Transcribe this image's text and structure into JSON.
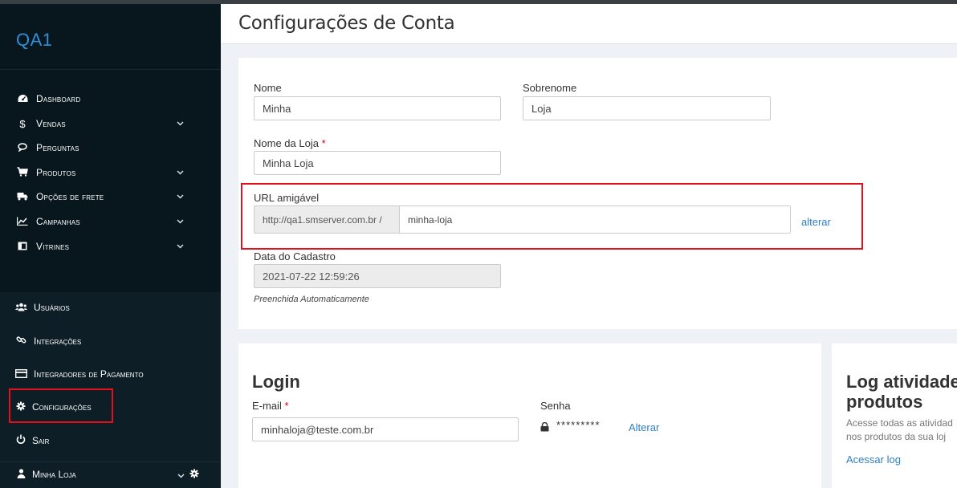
{
  "sidebar": {
    "brand": "QA1",
    "nav": [
      {
        "label": "Dashboard",
        "icon": "dashboard-icon",
        "chevron": false
      },
      {
        "label": "Vendas",
        "icon": "dollar-icon",
        "chevron": true
      },
      {
        "label": "Perguntas",
        "icon": "comments-icon",
        "chevron": false
      },
      {
        "label": "Produtos",
        "icon": "cart-icon",
        "chevron": true
      },
      {
        "label": "Opções de frete",
        "icon": "truck-icon",
        "chevron": true
      },
      {
        "label": "Campanhas",
        "icon": "chart-icon",
        "chevron": true
      },
      {
        "label": "Vitrines",
        "icon": "window-icon",
        "chevron": true
      }
    ],
    "lower": [
      {
        "label": "Usuários",
        "icon": "users-icon"
      },
      {
        "label": "Integrações",
        "icon": "link-icon"
      },
      {
        "label": "Integradores de Pagamento",
        "icon": "credit-card-icon"
      },
      {
        "label": "Configurações",
        "icon": "gear-icon"
      },
      {
        "label": "Sair",
        "icon": "power-icon"
      }
    ],
    "footer": {
      "label": "Minha Loja",
      "icon": "user-icon"
    }
  },
  "page": {
    "title": "Configurações de Conta"
  },
  "account_form": {
    "nome_label": "Nome",
    "nome_value": "Minha",
    "sobrenome_label": "Sobrenome",
    "sobrenome_value": "Loja",
    "loja_label": "Nome da Loja",
    "required_mark": "*",
    "loja_value": "Minha Loja",
    "url_label": "URL amigável",
    "url_prefix": "http://qa1.smserver.com.br /",
    "url_value": "minha-loja",
    "url_change_link": "alterar",
    "cadastro_label": "Data do Cadastro",
    "cadastro_value": "2021-07-22 12:59:26",
    "cadastro_hint": "Preenchida Automaticamente"
  },
  "login": {
    "title": "Login",
    "email_label": "E-mail",
    "email_value": "minhaloja@teste.com.br",
    "senha_label": "Senha",
    "senha_mask": "*********",
    "senha_change_link": "Alterar"
  },
  "log_panel": {
    "title_line1": "Log atividades",
    "title_line2": "produtos",
    "desc_line1": "Acesse todas as atividad",
    "desc_line2": "nos produtos da sua loj",
    "link": "Acessar log"
  },
  "colors": {
    "sidebar_bg": "#07171d",
    "brand": "#2f8fd8",
    "link": "#2f7fc1",
    "highlight": "#e5101a",
    "required": "#d0021b"
  }
}
